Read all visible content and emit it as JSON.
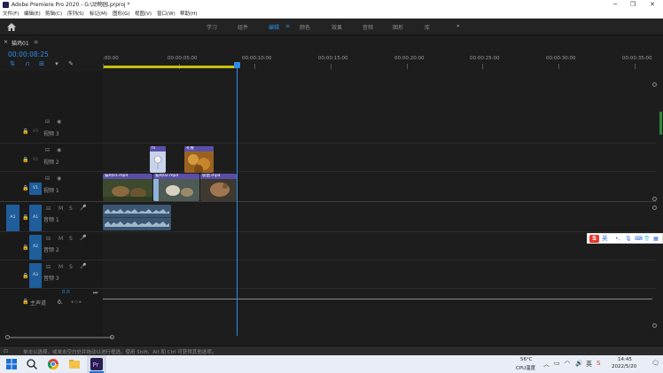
{
  "window": {
    "title": "Adobe Premiere Pro 2020 - G:\\动物园.prproj *",
    "minimize": "─",
    "maximize": "❐",
    "close": "✕"
  },
  "menu": [
    "文件(F)",
    "编辑(E)",
    "剪辑(C)",
    "序列(S)",
    "标记(M)",
    "图形(G)",
    "视图(V)",
    "窗口(W)",
    "帮助(H)"
  ],
  "workspaces": {
    "tabs": [
      "学习",
      "组件",
      "编辑",
      "颜色",
      "效果",
      "音频",
      "图形",
      "库"
    ],
    "active_index": 2,
    "more": "»",
    "active_menu": "≡"
  },
  "timeline": {
    "sequence_name": "猫鸡01",
    "close_symbol": "×",
    "menu_symbol": "≡",
    "timecode": "00:00:08:25",
    "ruler_labels": [
      ":00:00",
      "00:00:05:00",
      "00:00:10:00",
      "00:00:15:00",
      "00:00:20:00",
      "00:00:25:00",
      "00:00:30:00",
      "00:00:35:00"
    ],
    "master_volume": "0.0",
    "master_label": "主声道",
    "master_value": "0."
  },
  "tracks": {
    "video": [
      {
        "id": "V3",
        "name": "视频 3"
      },
      {
        "id": "V2",
        "name": "视频 2"
      },
      {
        "id": "V1",
        "name": "视频 1"
      }
    ],
    "audio": [
      {
        "id": "A1",
        "name": "音频 1",
        "source": "A1"
      },
      {
        "id": "A2",
        "name": "音频 2"
      },
      {
        "id": "A3",
        "name": "音频 3"
      }
    ],
    "track_buttons": {
      "mute": "M",
      "solo": "S",
      "mic": "🎙"
    }
  },
  "clips": {
    "v2": [
      {
        "label": "fx"
      },
      {
        "label": "孔雀"
      }
    ],
    "v1": [
      {
        "label": "猫鸡01.mp4"
      },
      {
        "label": "猫鸡02.mp4"
      },
      {
        "label": "袋鼠.mp4"
      }
    ]
  },
  "status": {
    "message": "单击以选择，或单击空白处并拖动以进行框选。使用 Shift、Alt 和 Ctrl 可获得其他选项。"
  },
  "ime": {
    "logo": "S",
    "lang": "英"
  },
  "taskbar": {
    "weather_temp": "56°C",
    "weather_label": "CPU温度",
    "time": "14:45",
    "date": "2022/5/20"
  },
  "colors": {
    "accent": "#2d8ceb",
    "workarea": "#c5c012",
    "video_clip": "#5a4fa8",
    "audio_clip": "#2e5a7a"
  }
}
